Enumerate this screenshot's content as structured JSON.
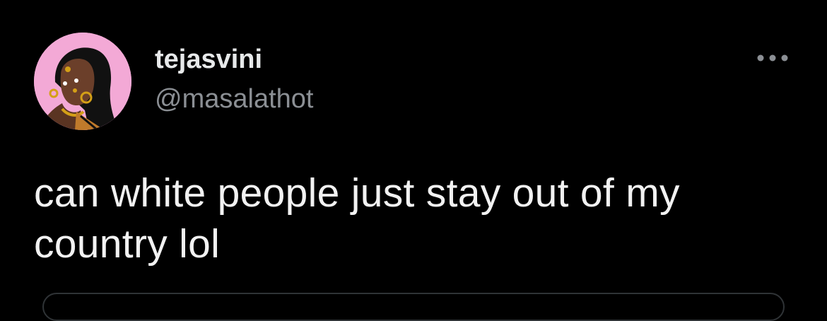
{
  "tweet": {
    "author": {
      "display_name": "tejasvini",
      "handle": "@masalathot",
      "avatar_icon": "illustrated-woman-avatar",
      "avatar_bg": "#f3a9d6"
    },
    "text": "can white people just stay out of my country lol",
    "more_icon": "more-dots-icon"
  },
  "colors": {
    "background": "#000000",
    "text_primary": "#e7e9ea",
    "text_secondary": "#8b8f94",
    "divider": "#2f3336"
  }
}
